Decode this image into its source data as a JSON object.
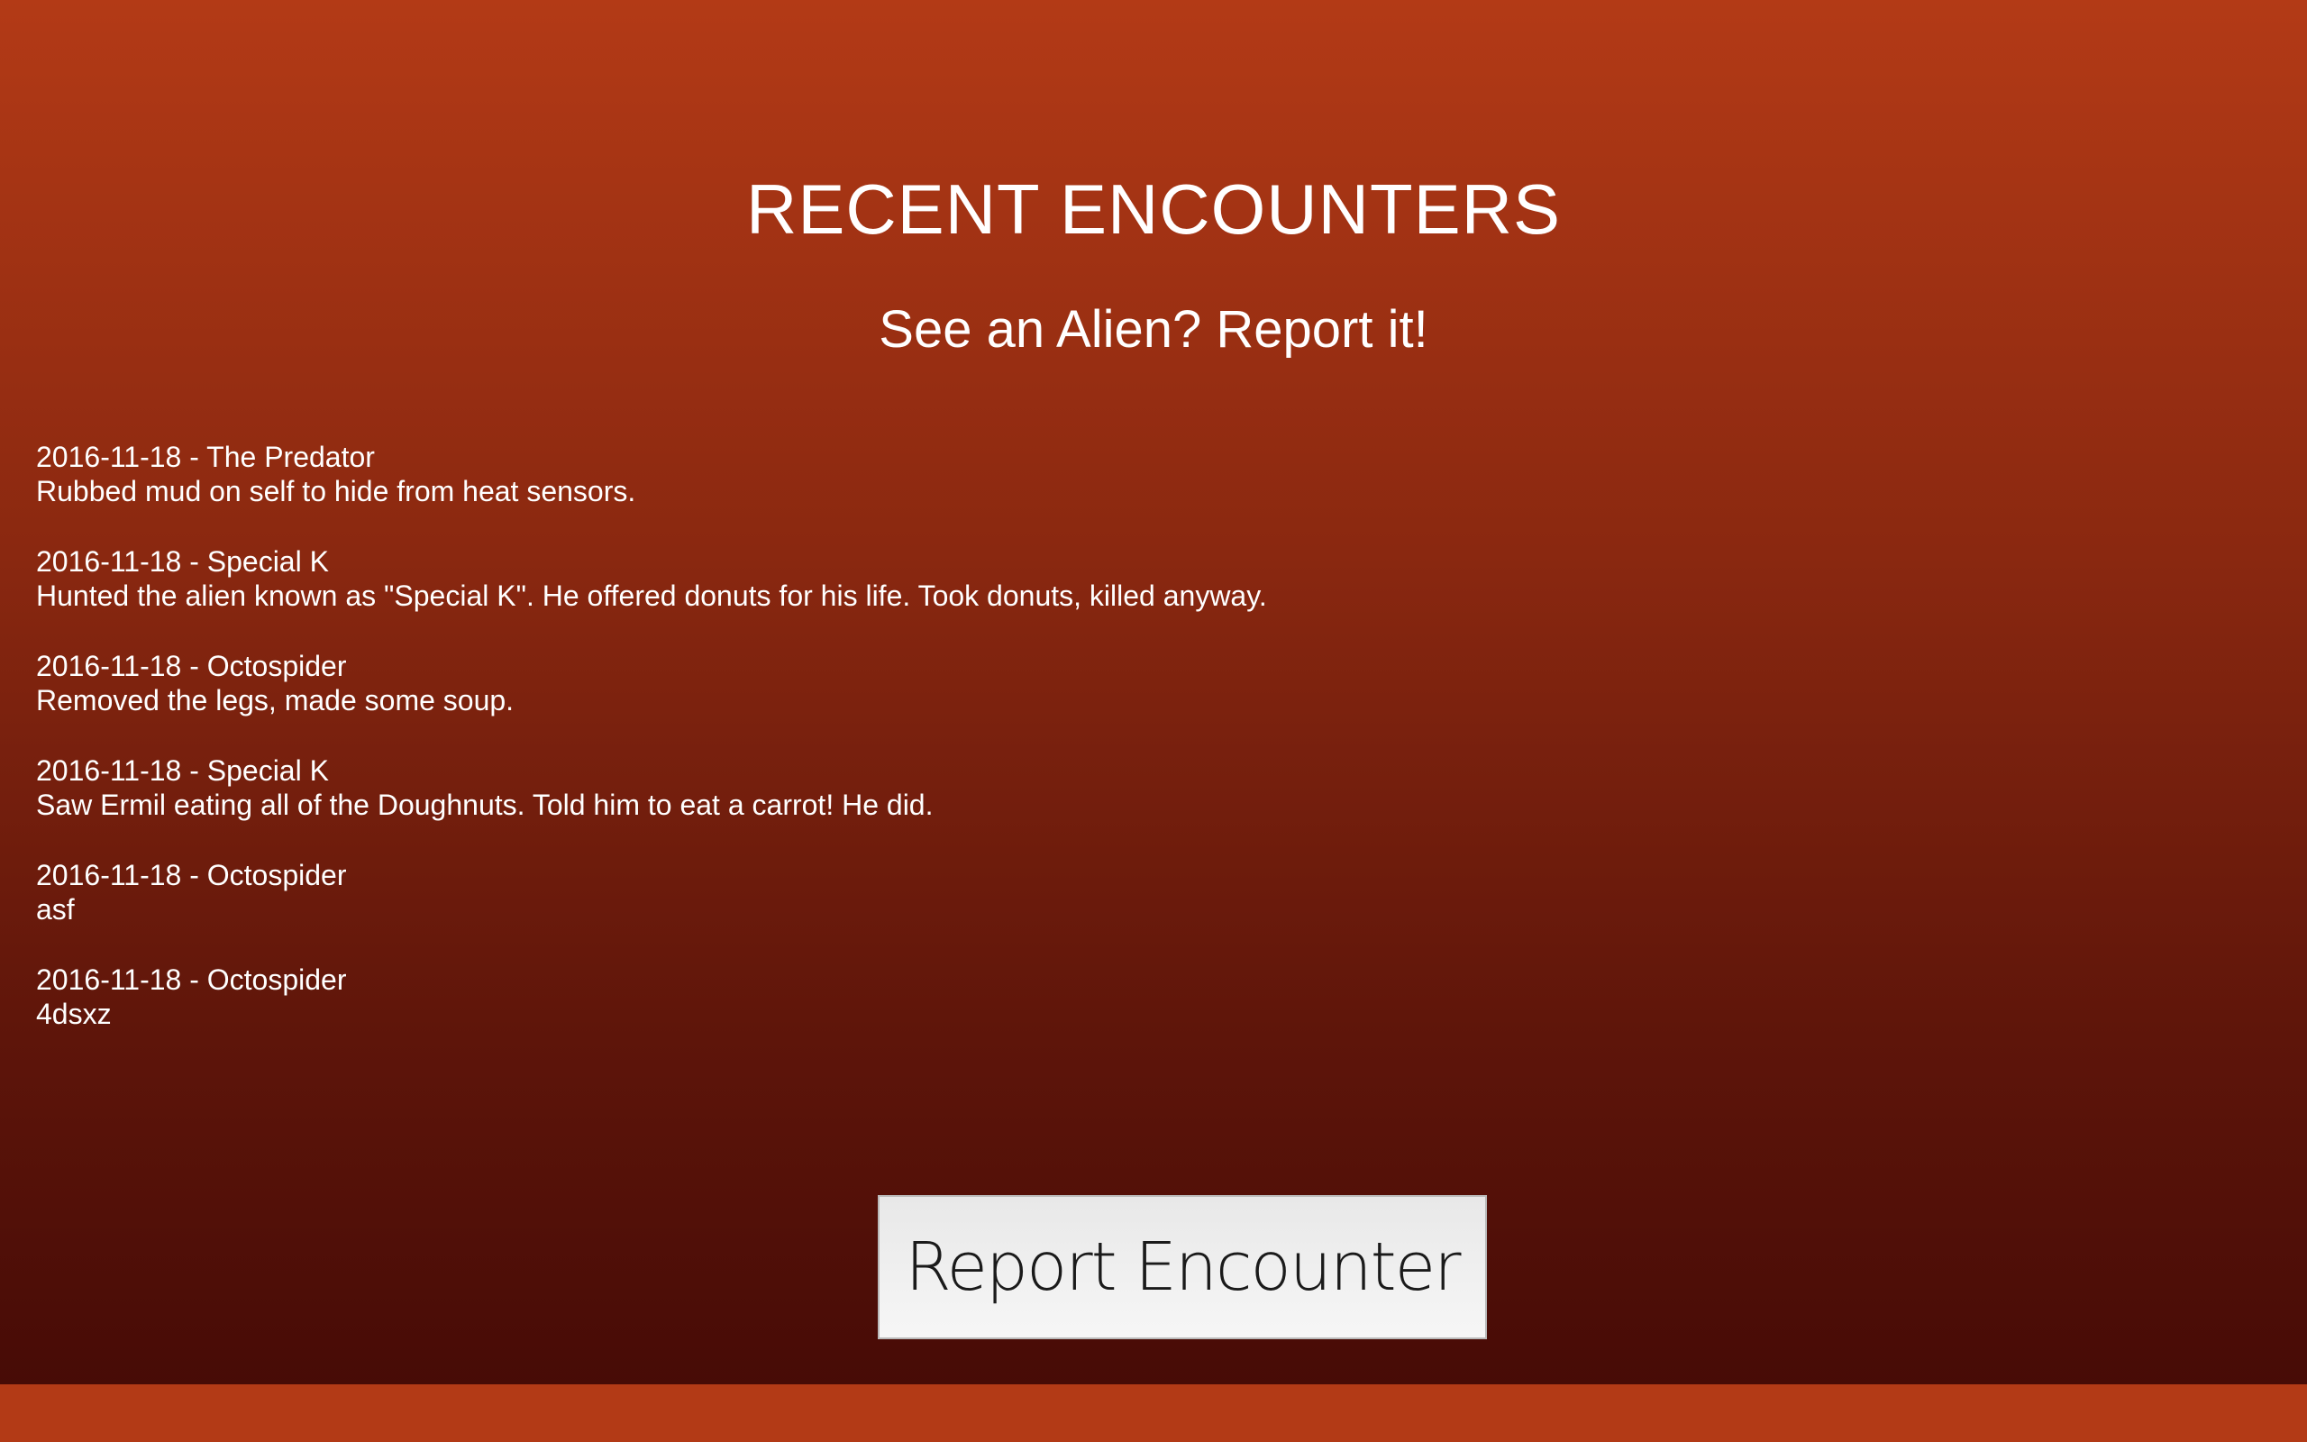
{
  "header": {
    "title": "RECENT ENCOUNTERS",
    "subtitle": "See an Alien? Report it!"
  },
  "encounters": [
    {
      "header": "2016-11-18 - The Predator",
      "description": "Rubbed mud on self to hide from heat sensors."
    },
    {
      "header": "2016-11-18 - Special K",
      "description": "Hunted the alien known as \"Special K\". He offered donuts for his life. Took donuts, killed anyway."
    },
    {
      "header": "2016-11-18 - Octospider",
      "description": "Removed the legs, made some soup."
    },
    {
      "header": "2016-11-18 - Special K",
      "description": "Saw Ermil eating all of the Doughnuts. Told him to eat a carrot! He did."
    },
    {
      "header": "2016-11-18 - Octospider",
      "description": "asf"
    },
    {
      "header": "2016-11-18 - Octospider",
      "description": "4dsxz"
    }
  ],
  "actions": {
    "report_label": "Report Encounter"
  },
  "colors": {
    "gradient_top": "#b33a16",
    "gradient_bottom": "#470b06",
    "button_bg": "#f0f0f0"
  }
}
